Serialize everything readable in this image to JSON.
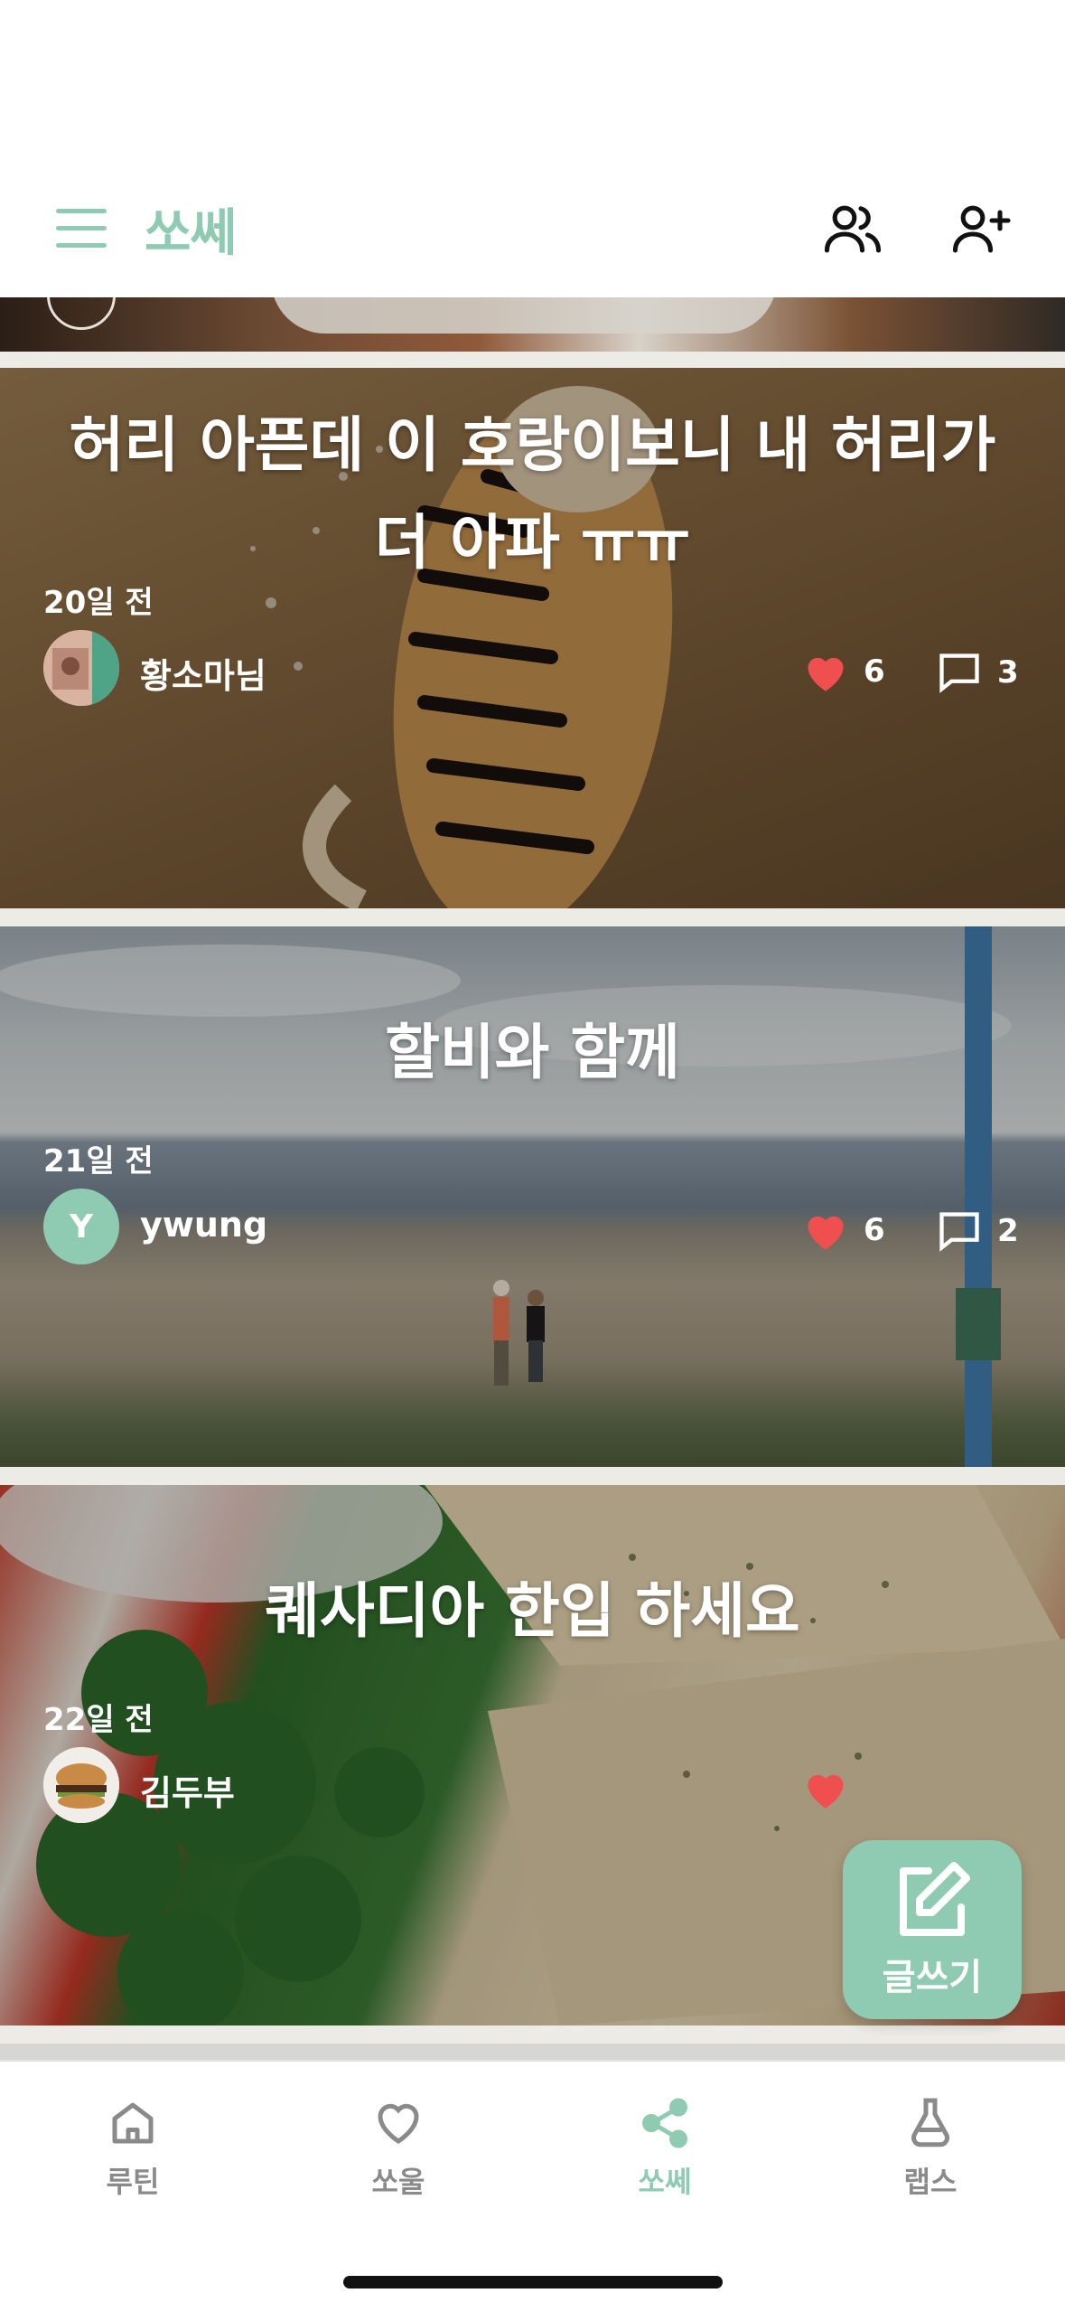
{
  "header": {
    "title": "쏘쎄",
    "menu_icon": "hamburger-menu-icon",
    "friends_icon": "users-icon",
    "add_friend_icon": "user-plus-icon"
  },
  "posts": [
    {
      "title": "허리 아픈데  이 호랑이보니 내 허리가 더 아파 ㅠㅠ",
      "date": "20일 전",
      "author": "황소마님",
      "likes": "6",
      "comments": "3"
    },
    {
      "title": "할비와 함께",
      "date": "21일 전",
      "author": "ywung",
      "avatar_letter": "Y",
      "likes": "6",
      "comments": "2"
    },
    {
      "title": "퀘사디아 한입 하세요",
      "date": "22일 전",
      "author": "김두부"
    }
  ],
  "fab": {
    "label": "글쓰기",
    "icon": "edit-icon"
  },
  "tabs": [
    {
      "label": "루틴",
      "icon": "home-icon"
    },
    {
      "label": "쏘울",
      "icon": "heart-icon"
    },
    {
      "label": "쏘쎄",
      "icon": "share-icon",
      "active": true
    },
    {
      "label": "랩스",
      "icon": "flask-icon"
    }
  ],
  "colors": {
    "accent": "#8ecbb2",
    "like": "#ef4f4f",
    "inactive": "#8a8a8a"
  }
}
